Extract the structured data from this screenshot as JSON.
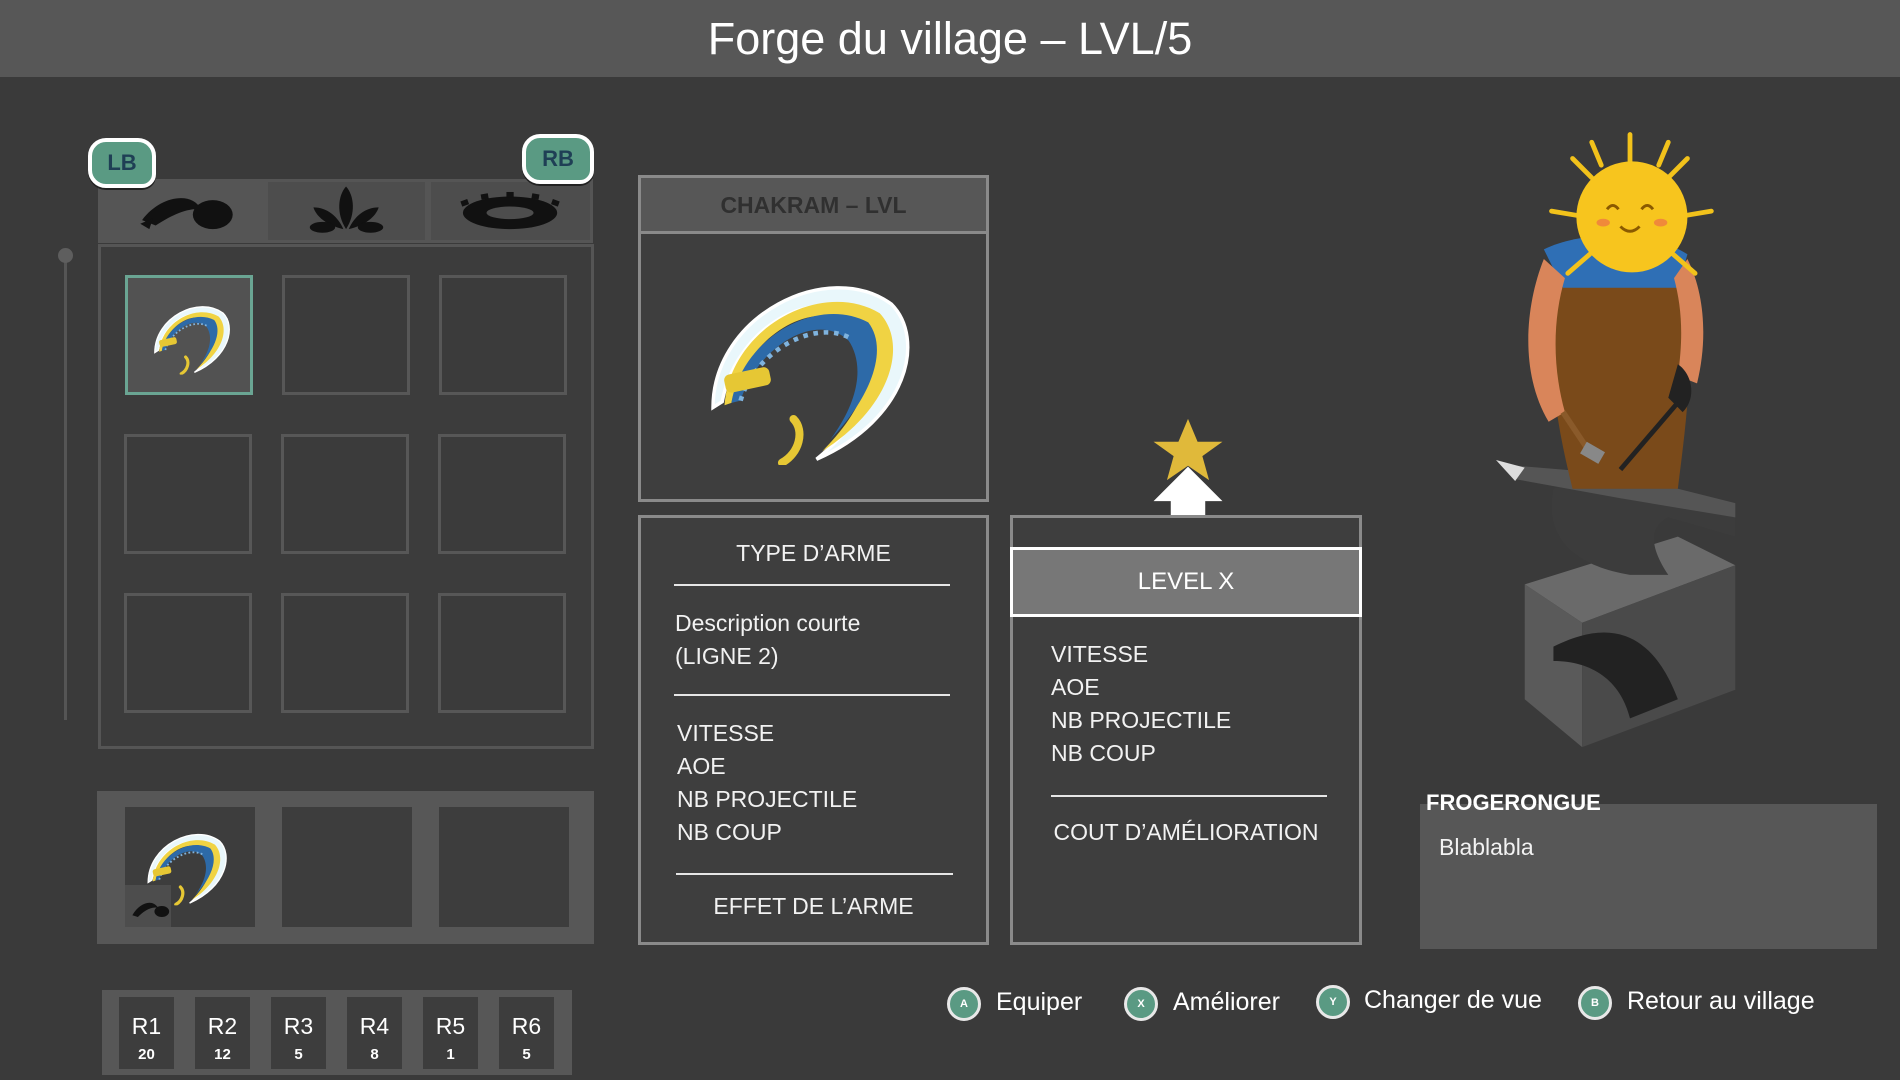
{
  "header": {
    "title": "Forge du village – LVL/5"
  },
  "inventory": {
    "lb_label": "LB",
    "rb_label": "RB",
    "tabs": [
      {
        "icon": "dagger-blob-icon"
      },
      {
        "icon": "plant-sprout-icon"
      },
      {
        "icon": "gear-ring-icon"
      }
    ]
  },
  "weapon": {
    "title": "CHAKRAM – LVL",
    "type": "TYPE D’ARME",
    "desc_line1": "Description courte",
    "desc_line2": "(LIGNE 2)",
    "stats": [
      "VITESSE",
      "AOE",
      "NB PROJECTILE",
      "NB COUP"
    ],
    "effect": "EFFET DE L’ARME"
  },
  "upgrade": {
    "level_label": "LEVEL X",
    "stats": [
      "VITESSE",
      "AOE",
      "NB PROJECTILE",
      "NB COUP"
    ],
    "cost": "COUT D’AMÉLIORATION"
  },
  "runes": [
    {
      "label": "R1",
      "count": "20"
    },
    {
      "label": "R2",
      "count": "12"
    },
    {
      "label": "R3",
      "count": "5"
    },
    {
      "label": "R4",
      "count": "8"
    },
    {
      "label": "R5",
      "count": "1"
    },
    {
      "label": "R6",
      "count": "5"
    }
  ],
  "npc": {
    "name": "FROGERONGUE",
    "dialogue": "Blablabla"
  },
  "controls": [
    {
      "button": "A",
      "label": "Equiper"
    },
    {
      "button": "X",
      "label": "Améliorer"
    },
    {
      "button": "Y",
      "label": "Changer de vue"
    },
    {
      "button": "B",
      "label": "Retour au village"
    }
  ],
  "colors": {
    "accent": "#5a9a83",
    "background": "#3a3a3a",
    "header": "#575757",
    "star": "#e0b93a"
  }
}
